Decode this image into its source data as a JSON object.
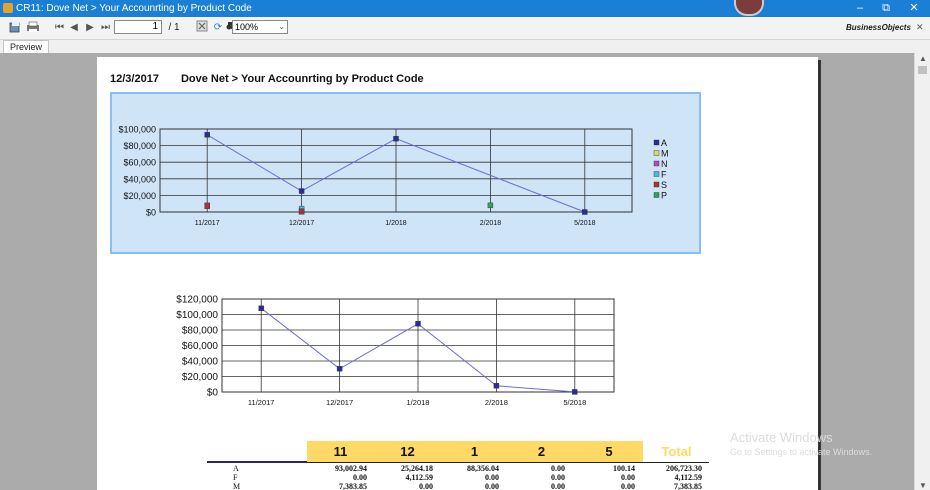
{
  "window": {
    "title": "CR11: Dove Net  > Your Accounrting by Product Code",
    "minimize": "–",
    "restore": "⧉",
    "close": "✕"
  },
  "toolbar": {
    "page_current": "1",
    "page_total": "/ 1",
    "zoom": "100%",
    "brand": "BusinessObjects"
  },
  "tabs": [
    {
      "label": "Preview"
    }
  ],
  "report": {
    "date": "12/3/2017",
    "title": "Dove Net  > Your Accounrting by Product Code"
  },
  "chart_data": [
    {
      "type": "line",
      "categories": [
        "11/2017",
        "12/2017",
        "1/2018",
        "2/2018",
        "5/2018"
      ],
      "y_ticks": [
        "$100,000",
        "$80,000",
        "$60,000",
        "$40,000",
        "$20,000",
        "$0"
      ],
      "ylim": [
        0,
        100000
      ],
      "legend": [
        "A",
        "M",
        "N",
        "F",
        "S",
        "P"
      ],
      "legend_position": "right",
      "colors": {
        "A": "#2b2b9a",
        "M": "#d8d86a",
        "N": "#c040c0",
        "F": "#40c0d0",
        "S": "#b03030",
        "P": "#30a060"
      },
      "series": [
        {
          "name": "A",
          "values": [
            93002.94,
            25264.18,
            88356.04,
            null,
            0
          ]
        },
        {
          "name": "M",
          "values": [
            7383.85,
            0,
            null,
            null,
            null
          ]
        },
        {
          "name": "N",
          "values": [
            8000,
            null,
            null,
            null,
            null
          ]
        },
        {
          "name": "F",
          "values": [
            null,
            4112.59,
            null,
            null,
            null
          ]
        },
        {
          "name": "S",
          "values": [
            7000,
            1000,
            null,
            null,
            null
          ]
        },
        {
          "name": "P",
          "values": [
            null,
            null,
            null,
            8000,
            null
          ]
        }
      ]
    },
    {
      "type": "line",
      "categories": [
        "11/2017",
        "12/2017",
        "1/2018",
        "2/2018",
        "5/2018"
      ],
      "y_ticks": [
        "$120,000",
        "$100,000",
        "$80,000",
        "$60,000",
        "$40,000",
        "$20,000",
        "$0"
      ],
      "ylim": [
        0,
        120000
      ],
      "series": [
        {
          "values": [
            108000,
            30000,
            88000,
            8000,
            100
          ]
        }
      ]
    }
  ],
  "table": {
    "columns": [
      "11",
      "12",
      "1",
      "2",
      "5",
      "Total"
    ],
    "rows": [
      {
        "label": "A",
        "values": [
          "93,002.94",
          "25,264.18",
          "88,356.04",
          "0.00",
          "100.14",
          "206,723.30"
        ]
      },
      {
        "label": "F",
        "values": [
          "0.00",
          "4,112.59",
          "0.00",
          "0.00",
          "0.00",
          "4,112.59"
        ]
      },
      {
        "label": "M",
        "values": [
          "7,383.85",
          "0.00",
          "0.00",
          "0.00",
          "0.00",
          "7,383.85"
        ]
      }
    ]
  },
  "watermark": {
    "line1": "Activate Windows",
    "line2": "Go to Settings to activate Windows."
  }
}
